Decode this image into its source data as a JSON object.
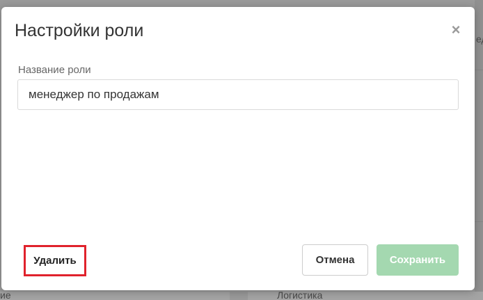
{
  "background": {
    "right_edge_text": "ед",
    "bottom_left_text": "ие",
    "bottom_right_text": "Логистика"
  },
  "modal": {
    "title": "Настройки роли",
    "close_symbol": "×",
    "role_name_label": "Название роли",
    "role_name_value": "менеджер по продажам",
    "delete_label": "Удалить",
    "cancel_label": "Отмена",
    "save_label": "Сохранить"
  },
  "colors": {
    "delete_highlight": "#e0222c",
    "save_button_disabled": "#a4d8b0",
    "overlay": "#9a9a9a"
  }
}
